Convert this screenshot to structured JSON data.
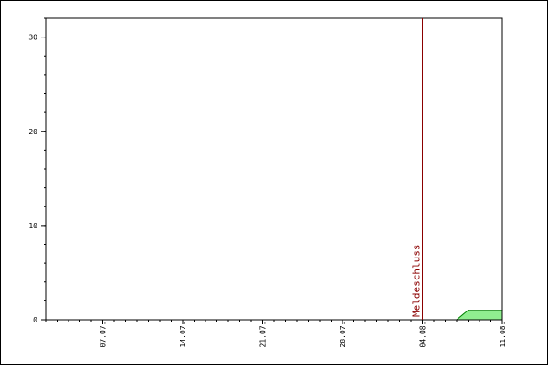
{
  "chart_data": {
    "type": "area",
    "title": "",
    "xlabel": "",
    "ylabel": "",
    "x_start": "2011-07-02",
    "x_end": "2011-08-11",
    "x_ticks": [
      {
        "date": "2011-07-07",
        "label": "07.07."
      },
      {
        "date": "2011-07-14",
        "label": "14.07."
      },
      {
        "date": "2011-07-21",
        "label": "21.07."
      },
      {
        "date": "2011-07-28",
        "label": "28.07."
      },
      {
        "date": "2011-08-04",
        "label": "04.08."
      },
      {
        "date": "2011-08-11",
        "label": "11.08."
      }
    ],
    "ylim": [
      0,
      32
    ],
    "y_ticks": [
      0,
      10,
      20,
      30
    ],
    "series": [
      {
        "points": [
          {
            "date": "2011-08-07",
            "value": 0
          },
          {
            "date": "2011-08-08",
            "value": 1
          },
          {
            "date": "2011-08-11",
            "value": 1
          }
        ]
      }
    ],
    "marker": {
      "date": "2011-08-04",
      "label": "Meldeschluss"
    },
    "grid": false,
    "colors": {
      "area": "#90ee90",
      "line": "#008000",
      "marker": "#8b0000",
      "axis": "#000000"
    }
  }
}
